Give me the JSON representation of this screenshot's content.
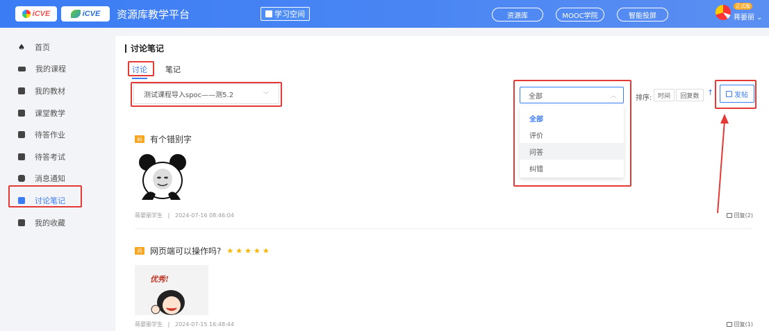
{
  "header": {
    "logo1_text": "iCVE",
    "logo2_text": "iCVE",
    "platform_title": "资源库教学平台",
    "study_space": "学习空间",
    "nav": [
      "资源库",
      "MOOC学院",
      "智能投屏"
    ],
    "user_badge": "正式版",
    "user_name": "蒋晏丽 ⌄"
  },
  "sidebar": {
    "items": [
      {
        "label": "首页",
        "icon": "home-icon"
      },
      {
        "label": "我的课程",
        "icon": "courses-icon"
      },
      {
        "label": "我的教材",
        "icon": "book-icon"
      },
      {
        "label": "课堂教学",
        "icon": "play-icon"
      },
      {
        "label": "待答作业",
        "icon": "homework-icon"
      },
      {
        "label": "待答考试",
        "icon": "exam-icon"
      },
      {
        "label": "消息通知",
        "icon": "message-icon"
      },
      {
        "label": "讨论笔记",
        "icon": "discussion-icon"
      },
      {
        "label": "我的收藏",
        "icon": "favorite-icon"
      }
    ]
  },
  "main": {
    "title": "讨论笔记",
    "tabs": [
      "讨论",
      "笔记"
    ],
    "course_select": "测试课程导入spoc——测5.2",
    "filter_select": "全部",
    "filter_options": [
      "全部",
      "评价",
      "问答",
      "纠错"
    ],
    "sort_label": "排序:",
    "sort_options": [
      "时间",
      "回复数"
    ],
    "sort_arrow": "↑",
    "post_button": "发帖",
    "posts": [
      {
        "tag": "纠",
        "title": "有个错别字",
        "author": "蒋晏丽学生",
        "sep": "|",
        "time": "2024-07-16 08:46:04",
        "reply": "回复(2)"
      },
      {
        "tag": "问",
        "title": "网页端可以操作吗?",
        "stars": "★★★★★",
        "author": "蒋晏丽学生",
        "sep": "|",
        "time": "2024-07-15 16:48:44",
        "reply": "回复(1)",
        "sticker_text": "优秀!"
      }
    ]
  },
  "colors": {
    "accent": "#3b7cf5",
    "highlight": "#e53935",
    "star": "#f7b500"
  }
}
